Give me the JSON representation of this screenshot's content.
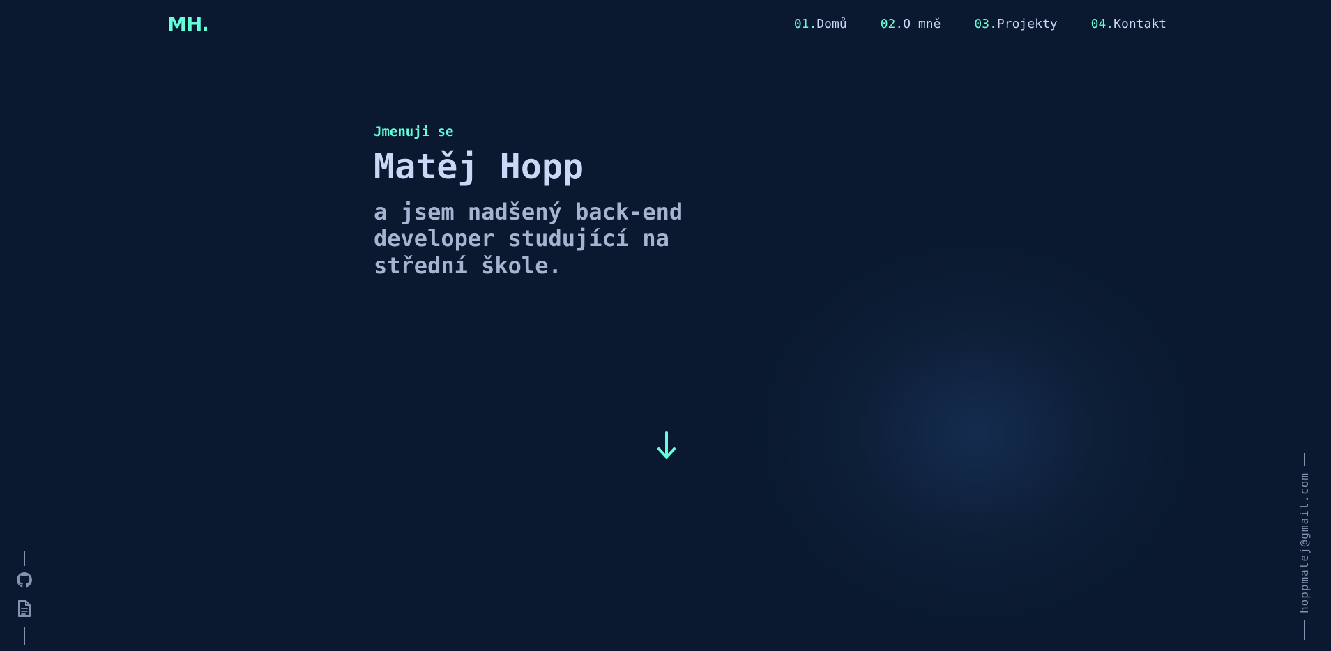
{
  "header": {
    "logo": "MH.",
    "nav": [
      {
        "num": "01.",
        "label": "Domů"
      },
      {
        "num": "02.",
        "label": "O mně"
      },
      {
        "num": "03.",
        "label": "Projekty"
      },
      {
        "num": "04.",
        "label": "Kontakt"
      }
    ]
  },
  "hero": {
    "intro": "Jmenuji se",
    "name": "Matěj Hopp",
    "tagline": "a jsem nadšený back-end developer studující na střední škole."
  },
  "scroll": {
    "icon": "arrow-down-icon"
  },
  "social": {
    "icons": [
      "github-icon",
      "document-icon"
    ]
  },
  "contact": {
    "email": "hoppmatej@gmail.com"
  },
  "colors": {
    "background": "#0a192f",
    "accent": "#64ffda",
    "heading": "#ccd6f6",
    "text": "#a8b2d1",
    "muted": "#8892b0"
  }
}
